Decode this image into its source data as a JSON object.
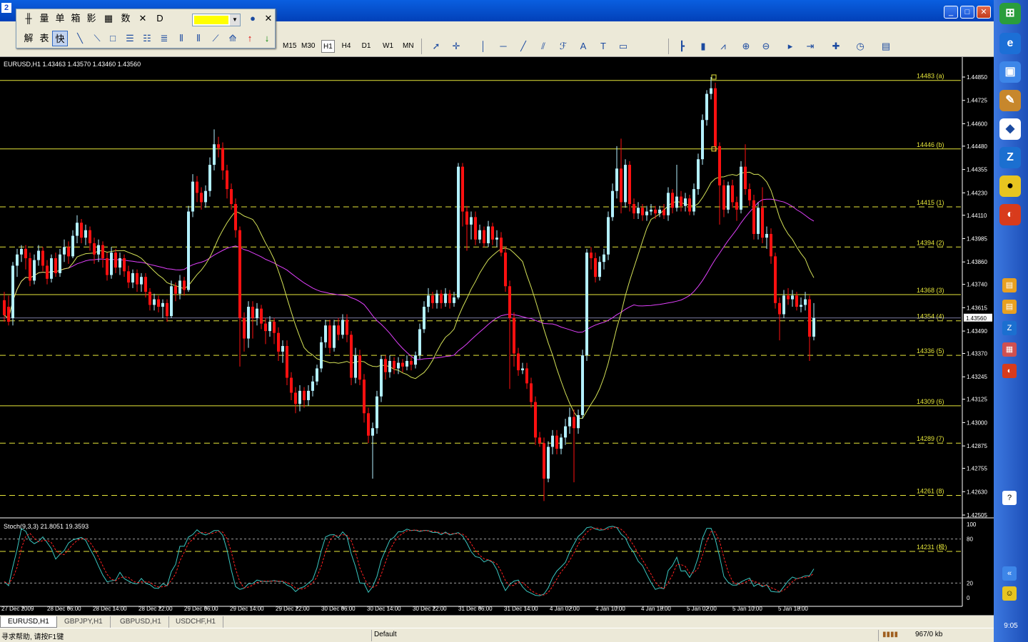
{
  "window": {
    "app_icon": "2",
    "min_label": "_",
    "max_label": "□",
    "close_label": "✕"
  },
  "float_toolbar": {
    "row1": [
      "量",
      "单",
      "箱",
      "影",
      "数"
    ],
    "row2": [
      "解",
      "表",
      "快"
    ],
    "highlight_color": "#ffff00"
  },
  "timeframes": [
    "M15",
    "M30",
    "H1",
    "H4",
    "D1",
    "W1",
    "MN"
  ],
  "active_timeframe": "H1",
  "toolbar_text_tools": [
    "A",
    "T"
  ],
  "chart": {
    "header": "EURUSD,H1  1.43463 1.43570 1.43460 1.43560",
    "price_ticks": [
      "1.44850",
      "1.44725",
      "1.44600",
      "1.44480",
      "1.44355",
      "1.44230",
      "1.44110",
      "1.43985",
      "1.43860",
      "1.43740",
      "1.43615",
      "1.43490",
      "1.43370",
      "1.43245",
      "1.43125",
      "1.43000",
      "1.42875",
      "1.42755",
      "1.42630",
      "1.42505"
    ],
    "current_price": "1.43560",
    "levels": [
      {
        "label": "14483 (a)",
        "style": "solid",
        "price": 1.44832
      },
      {
        "label": "14446 (b)",
        "style": "solid",
        "price": 1.44465
      },
      {
        "label": "14415 (1)",
        "style": "dashed",
        "price": 1.44155
      },
      {
        "label": "14394 (2)",
        "style": "dashed",
        "price": 1.4394
      },
      {
        "label": "14368 (3)",
        "style": "solid",
        "price": 1.43685
      },
      {
        "label": "14354 (4)",
        "style": "dashed",
        "price": 1.43545
      },
      {
        "label": "14336 (5)",
        "style": "dashed",
        "price": 1.4336
      },
      {
        "label": "14309 (6)",
        "style": "solid",
        "price": 1.4309
      },
      {
        "label": "14289 (7)",
        "style": "dashed",
        "price": 1.4289
      },
      {
        "label": "14261 (8)",
        "style": "dashed",
        "price": 1.4261
      }
    ],
    "time_labels": [
      "27 Dec 2009",
      "28 Dec 06:00",
      "28 Dec 14:00",
      "28 Dec 22:00",
      "29 Dec 06:00",
      "29 Dec 14:00",
      "29 Dec 22:00",
      "30 Dec 06:00",
      "30 Dec 14:00",
      "30 Dec 22:00",
      "31 Dec 06:00",
      "31 Dec 14:00",
      "4 Jan 02:00",
      "4 Jan 10:00",
      "4 Jan 18:00",
      "5 Jan 02:00",
      "5 Jan 10:00",
      "5 Jan 18:00"
    ],
    "ma_fast_color": "#d4e157",
    "ma_slow_color": "#e040fb",
    "bull_color": "#b3f0ff",
    "bear_color": "#ff1010"
  },
  "stoch": {
    "header": "Stoch(9,3,3) 21.8051 19.3593",
    "ticks": [
      "100",
      "80",
      "20",
      "0"
    ],
    "level_label": "14231 (极)",
    "main_color": "#39c6c0",
    "signal_color": "#ff2020"
  },
  "tabs": [
    "EURUSD,H1",
    "GBPJPY,H1",
    "GBPUSD,H1",
    "USDCHF,H1"
  ],
  "active_tab": "EURUSD,H1",
  "status": {
    "help": "寻求帮助, 请按F1键",
    "profile": "Default",
    "traffic": "967/0 kb"
  },
  "taskbar": {
    "clock": "9:05"
  }
}
